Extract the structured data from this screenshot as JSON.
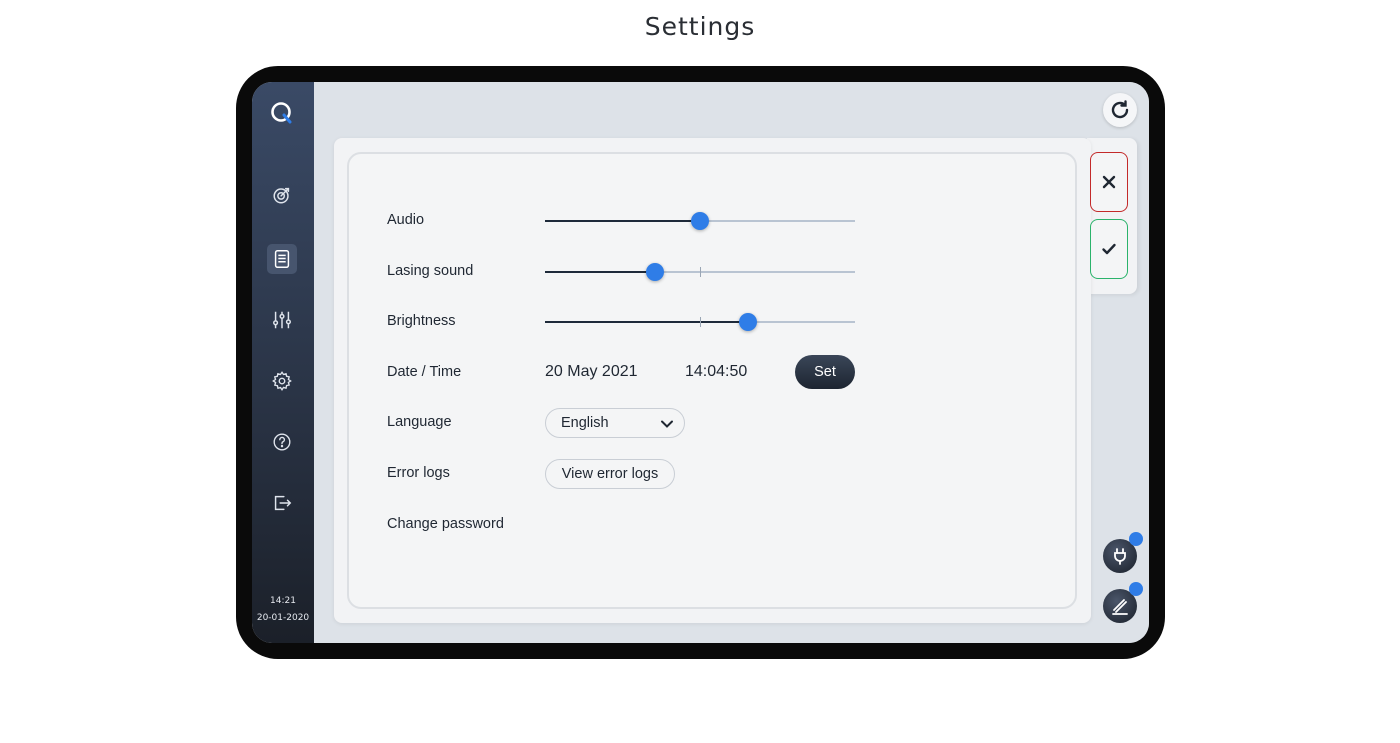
{
  "page": {
    "title": "Settings"
  },
  "sidebar": {
    "icons": [
      "logo-q-icon",
      "target-icon",
      "document-icon",
      "sliders-icon",
      "gear-icon",
      "help-icon",
      "logout-icon"
    ],
    "active": "document-icon",
    "time": "14:21",
    "date": "20-01-2020"
  },
  "toolbar": {
    "refresh_icon": "refresh-icon"
  },
  "actions": {
    "cancel_icon": "close-icon",
    "confirm_icon": "check-icon",
    "cancel_color": "#c32a2a",
    "confirm_color": "#2bb36b"
  },
  "settings": {
    "audio": {
      "label": "Audio",
      "value": 0.5
    },
    "lasing_sound": {
      "label": "Lasing sound",
      "value": 0.355,
      "marker": 0.5
    },
    "brightness": {
      "label": "Brightness",
      "value": 0.655,
      "marker": 0.5
    },
    "datetime": {
      "label": "Date / Time",
      "date": "20 May 2021",
      "time": "14:04:50",
      "set_label": "Set"
    },
    "language": {
      "label": "Language",
      "selected": "English"
    },
    "error_logs": {
      "label": "Error logs",
      "button_label": "View error logs"
    },
    "change_password": {
      "label": "Change password"
    }
  },
  "status": {
    "power_icon": "plug-icon",
    "pen_icon": "pen-icon",
    "accent": "#2f7de7"
  }
}
